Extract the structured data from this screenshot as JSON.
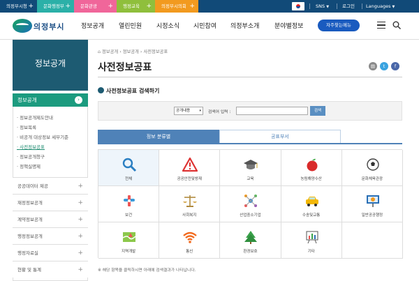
{
  "topbar": {
    "tabs": [
      {
        "label": "의정부시청",
        "color": "#114a78"
      },
      {
        "label": "문화행정부",
        "color": "#2bb0a8"
      },
      {
        "label": "문화관광",
        "color": "#f0669a"
      },
      {
        "label": "행정교육",
        "color": "#8fbf3c"
      },
      {
        "label": "의정부시의회",
        "color": "#f29a1f"
      }
    ],
    "plus": "+",
    "sns": "SNS",
    "login": "로그인",
    "languages": "Languages"
  },
  "header": {
    "logo": "의정부시",
    "menu": [
      "정보공개",
      "열린민원",
      "시정소식",
      "시민참여",
      "의정부소개",
      "분야별정보"
    ],
    "cta": "자주찾는메뉴"
  },
  "sidebar": {
    "title": "정보공개",
    "active": "정보공개",
    "sub_items": [
      "정보공개제도안내",
      "정보목록",
      "비공개 대상정보 세부기준",
      "사전정보공표",
      "정보공개청구",
      "정책실명제"
    ],
    "menus": [
      "공공데이터 제공",
      "재정정보공개",
      "계약정보공개",
      "행정정보공개",
      "행정자료실",
      "현황 및 통계"
    ]
  },
  "main": {
    "breadcrumb": [
      "정보공개",
      "정보공개",
      "사전정보공표"
    ],
    "title": "사전정보공표",
    "section_title": "사전정보공표 검색하기",
    "search": {
      "select_value": "공개내용",
      "label": "검색어 입력 :",
      "input_value": "",
      "button": "검색"
    },
    "tabs": [
      "정보 분류별",
      "공표부서"
    ],
    "categories": [
      {
        "label": "전체",
        "icon": "magnifier-icon"
      },
      {
        "label": "공공안전및방재",
        "icon": "warning-icon"
      },
      {
        "label": "교육",
        "icon": "graduation-cap-icon"
      },
      {
        "label": "농림해양수산",
        "icon": "apple-icon"
      },
      {
        "label": "문화체육관광",
        "icon": "soccer-ball-icon"
      },
      {
        "label": "보건",
        "icon": "health-icon"
      },
      {
        "label": "사회복지",
        "icon": "scales-icon"
      },
      {
        "label": "산업중소기업",
        "icon": "network-icon"
      },
      {
        "label": "수송및교통",
        "icon": "car-icon"
      },
      {
        "label": "일반공공행정",
        "icon": "presentation-icon"
      },
      {
        "label": "지역개발",
        "icon": "map-icon"
      },
      {
        "label": "통신",
        "icon": "wifi-icon"
      },
      {
        "label": "환경보호",
        "icon": "tree-icon"
      },
      {
        "label": "기타",
        "icon": "chart-board-icon"
      }
    ],
    "note": "※ 해당 항목을 클릭하시면 아래에 검색결과가 나타납니다."
  }
}
